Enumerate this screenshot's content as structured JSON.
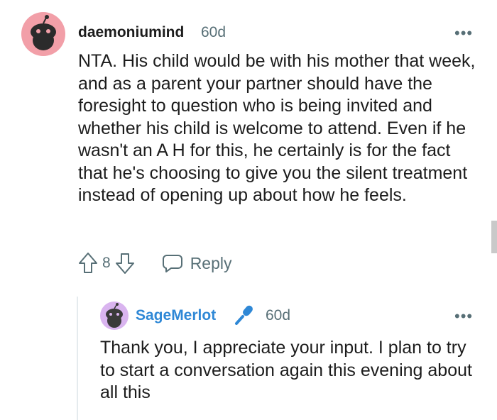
{
  "comment": {
    "username": "daemoniumind",
    "age": "60d",
    "text": "NTA. His child would be with his mother that week, and as a parent your partner should have the foresight to question who is being invited and whether his child is welcome to attend. Even if he wasn't an A H for this, he certainly is for the fact that he's choosing to give you the silent treatment instead of opening up about how he feels.",
    "votes": "8",
    "reply_label": "Reply",
    "more_label": "•••",
    "avatar_color": "#f29fa8"
  },
  "reply": {
    "username": "SageMerlot",
    "age": "60d",
    "text": "Thank you, I appreciate your input. I plan to try to start a conversation again this evening about all this",
    "more_label": "•••",
    "username_color": "#2f88d6",
    "badge_icon": "microphone-icon",
    "avatar_color": "#d9b4ef"
  }
}
